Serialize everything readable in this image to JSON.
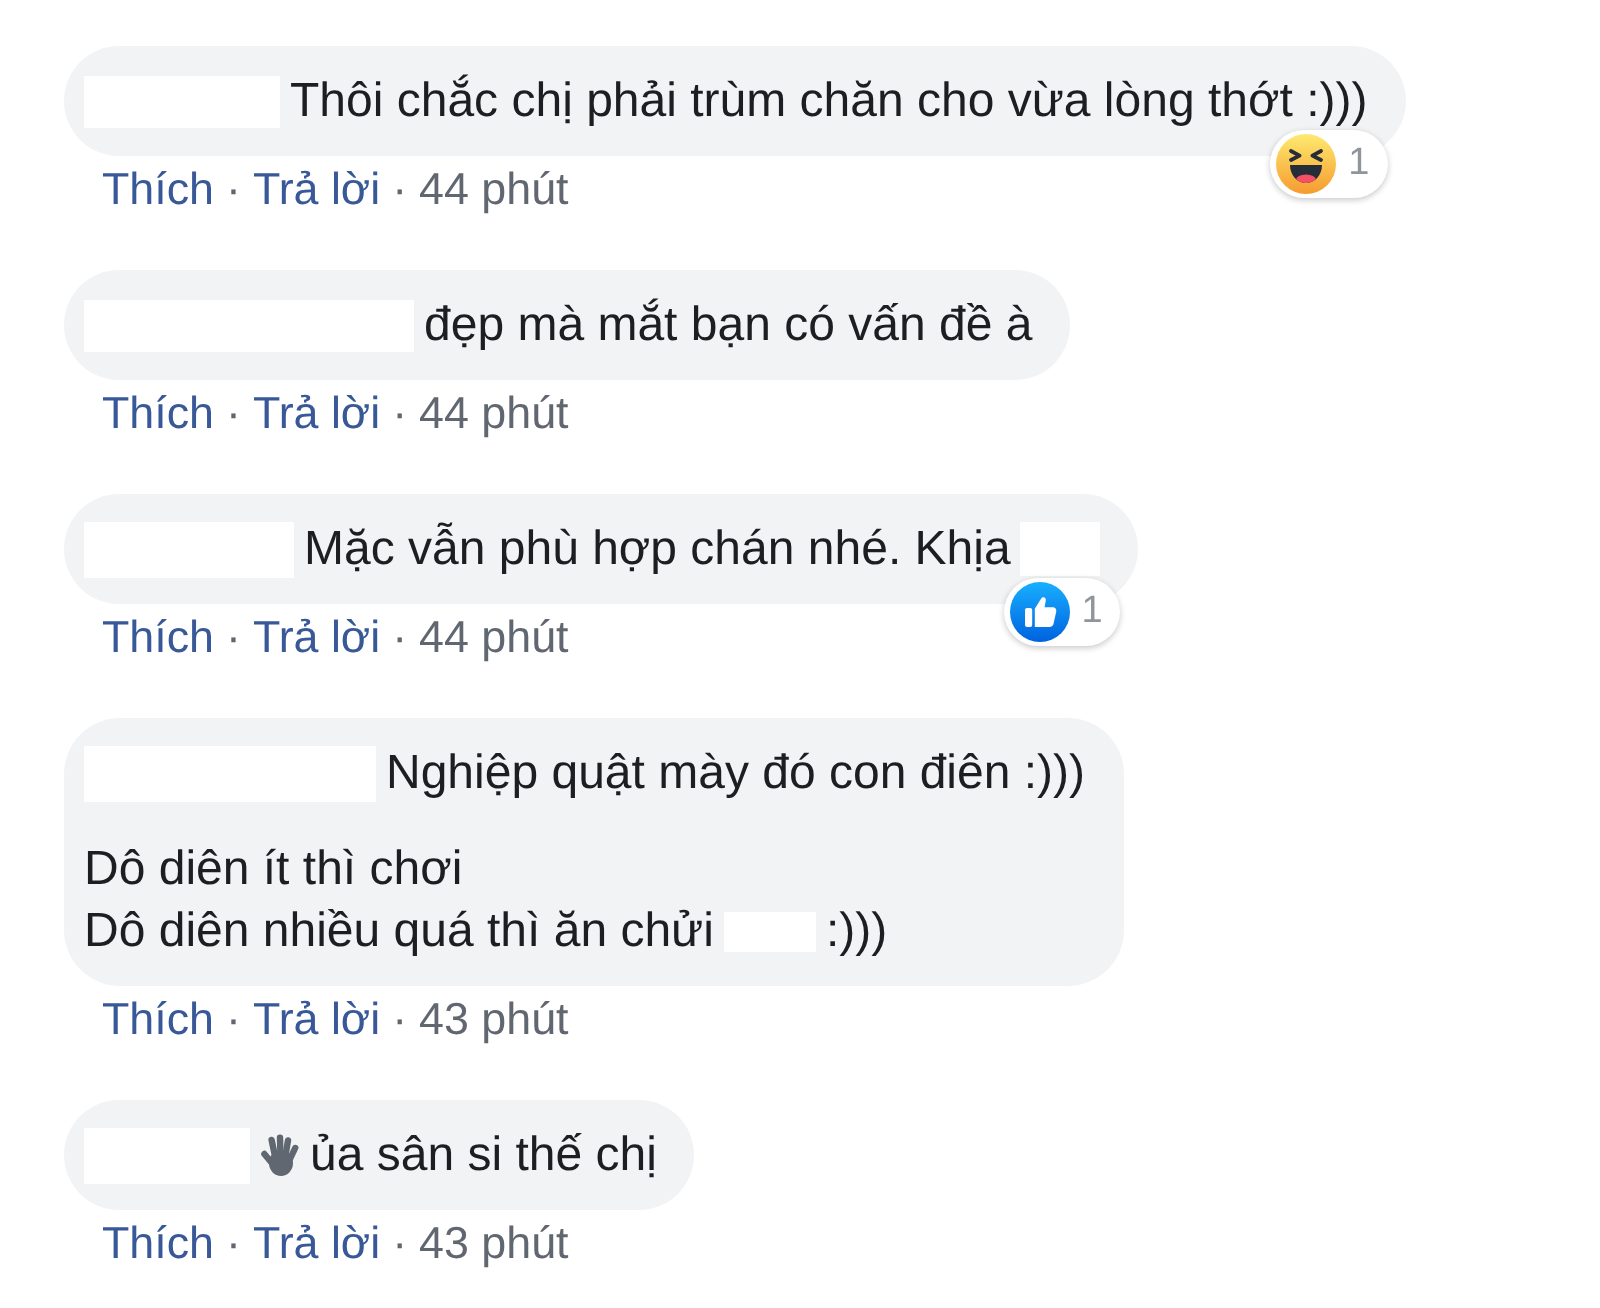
{
  "comments": [
    {
      "paragraphs": [
        {
          "lines": [
            {
              "parts": [
                {
                  "kind": "redaction"
                },
                {
                  "kind": "text",
                  "text": "Thôi chắc chị phải trùm chăn cho vừa lòng thớt :)))"
                }
              ]
            }
          ]
        }
      ],
      "reaction": {
        "kind": "haha",
        "count": "1"
      },
      "actions": [
        {
          "kind": "like",
          "text": "Thích"
        },
        {
          "kind": "separator",
          "text": "·"
        },
        {
          "kind": "reply",
          "text": "Trả lời"
        },
        {
          "kind": "separator",
          "text": "·"
        },
        {
          "kind": "time",
          "text": "44 phút"
        }
      ]
    },
    {
      "paragraphs": [
        {
          "lines": [
            {
              "parts": [
                {
                  "kind": "redaction"
                },
                {
                  "kind": "text",
                  "text": "đẹp mà mắt bạn có vấn đề à"
                }
              ]
            }
          ]
        }
      ],
      "actions": [
        {
          "kind": "like",
          "text": "Thích"
        },
        {
          "kind": "separator",
          "text": "·"
        },
        {
          "kind": "reply",
          "text": "Trả lời"
        },
        {
          "kind": "separator",
          "text": "·"
        },
        {
          "kind": "time",
          "text": "44 phút"
        }
      ]
    },
    {
      "paragraphs": [
        {
          "lines": [
            {
              "parts": [
                {
                  "kind": "redaction"
                },
                {
                  "kind": "text",
                  "text": "Mặc vẫn phù hợp chán nhé. Khịa"
                },
                {
                  "kind": "redaction"
                }
              ]
            }
          ]
        }
      ],
      "reaction": {
        "kind": "like",
        "count": "1"
      },
      "actions": [
        {
          "kind": "like",
          "text": "Thích"
        },
        {
          "kind": "separator",
          "text": "·"
        },
        {
          "kind": "reply",
          "text": "Trả lời"
        },
        {
          "kind": "separator",
          "text": "·"
        },
        {
          "kind": "time",
          "text": "44 phút"
        }
      ]
    },
    {
      "paragraphs": [
        {
          "lines": [
            {
              "parts": [
                {
                  "kind": "redaction"
                },
                {
                  "kind": "text",
                  "text": "Nghiệp quật mày đó con điên :)))"
                }
              ]
            }
          ]
        },
        {
          "lines": [
            {
              "parts": [
                {
                  "kind": "text",
                  "text": "Dô diên ít thì chơi"
                }
              ]
            },
            {
              "parts": [
                {
                  "kind": "text",
                  "text": "Dô diên nhiều quá thì ăn chửi"
                },
                {
                  "kind": "redaction"
                },
                {
                  "kind": "text",
                  "text": ":)))"
                }
              ]
            }
          ]
        }
      ],
      "actions": [
        {
          "kind": "like",
          "text": "Thích"
        },
        {
          "kind": "separator",
          "text": "·"
        },
        {
          "kind": "reply",
          "text": "Trả lời"
        },
        {
          "kind": "separator",
          "text": "·"
        },
        {
          "kind": "time",
          "text": "43 phút"
        }
      ]
    },
    {
      "paragraphs": [
        {
          "lines": [
            {
              "parts": [
                {
                  "kind": "redaction"
                },
                {
                  "kind": "emoji"
                },
                {
                  "kind": "text",
                  "text": "ủa sân si thế chị"
                }
              ]
            }
          ]
        }
      ],
      "actions": [
        {
          "kind": "like",
          "text": "Thích"
        },
        {
          "kind": "separator",
          "text": "·"
        },
        {
          "kind": "reply",
          "text": "Trả lời"
        },
        {
          "kind": "separator",
          "text": "·"
        },
        {
          "kind": "time",
          "text": "43 phút"
        }
      ]
    }
  ]
}
